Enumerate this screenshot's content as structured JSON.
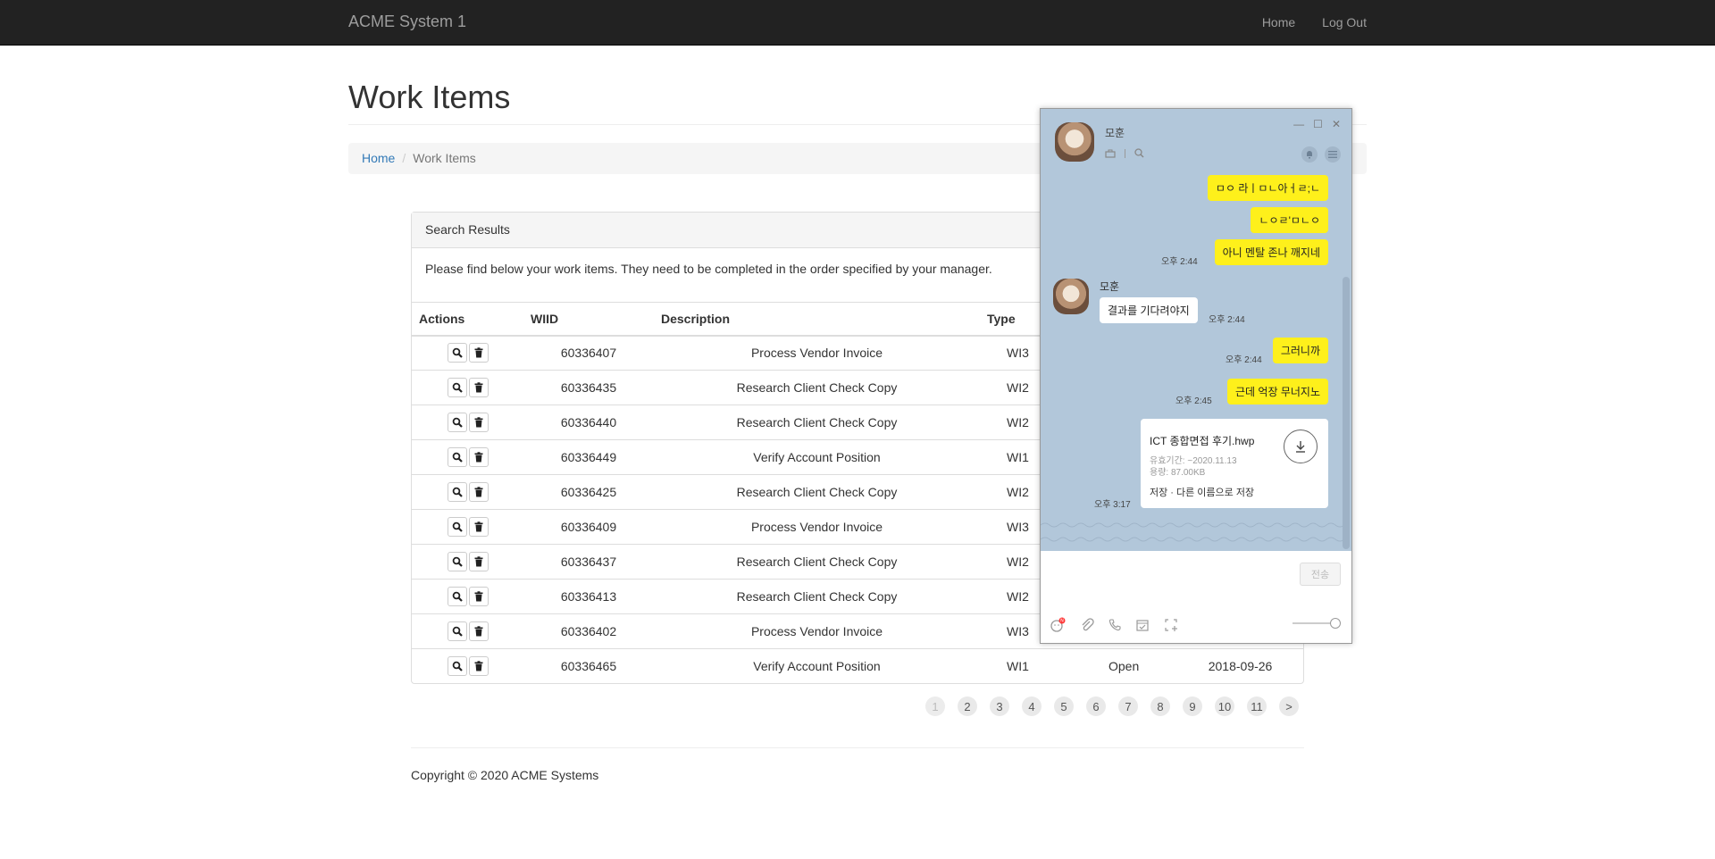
{
  "navbar": {
    "brand": "ACME System 1",
    "links": [
      "Home",
      "Log Out"
    ]
  },
  "page": {
    "title": "Work Items",
    "breadcrumb": {
      "home": "Home",
      "current": "Work Items"
    }
  },
  "panel": {
    "heading": "Search Results",
    "body": "Please find below your work items. They need to be completed in the order specified by your manager.",
    "columns": [
      "Actions",
      "WIID",
      "Description",
      "Type"
    ],
    "rows": [
      {
        "wiid": "60336407",
        "desc": "Process Vendor Invoice",
        "type": "WI3"
      },
      {
        "wiid": "60336435",
        "desc": "Research Client Check Copy",
        "type": "WI2"
      },
      {
        "wiid": "60336440",
        "desc": "Research Client Check Copy",
        "type": "WI2"
      },
      {
        "wiid": "60336449",
        "desc": "Verify Account Position",
        "type": "WI1"
      },
      {
        "wiid": "60336425",
        "desc": "Research Client Check Copy",
        "type": "WI2"
      },
      {
        "wiid": "60336409",
        "desc": "Process Vendor Invoice",
        "type": "WI3"
      },
      {
        "wiid": "60336437",
        "desc": "Research Client Check Copy",
        "type": "WI2"
      },
      {
        "wiid": "60336413",
        "desc": "Research Client Check Copy",
        "type": "WI2"
      },
      {
        "wiid": "60336402",
        "desc": "Process Vendor Invoice",
        "type": "WI3"
      },
      {
        "wiid": "60336465",
        "desc": "Verify Account Position",
        "type": "WI1",
        "status": "Open",
        "date": "2018-09-26"
      }
    ]
  },
  "pagination": [
    "1",
    "2",
    "3",
    "4",
    "5",
    "6",
    "7",
    "8",
    "9",
    "10",
    "11",
    ">"
  ],
  "footer": "Copyright © 2020 ACME Systems",
  "chat": {
    "contact": "모훈",
    "messages": {
      "m1": "ㅁㅇ 라ㅣㅁㄴ아ㅓㄹ;ㄴ",
      "m2": "ㄴㅇㄹ'ㅁㄴㅇ",
      "m3": "아니 멘탈 존나 깨지네",
      "t3": "오후 2:44",
      "o1": "결과를 기다려야지",
      "t4": "오후 2:44",
      "m4": "그러니까",
      "t5": "오후 2:44",
      "m5": "근데 억장 무너지노",
      "t6": "오후 2:45",
      "t7": "오후 3:17"
    },
    "file": {
      "name": "ICT 종합면접 후기.hwp",
      "expiry": "유효기간: ~2020.11.13",
      "size": "용량: 87.00KB",
      "actions": "저장 · 다른 이름으로 저장"
    },
    "send_label": "전송",
    "window_buttons": [
      "—",
      "☐",
      "✕"
    ]
  }
}
